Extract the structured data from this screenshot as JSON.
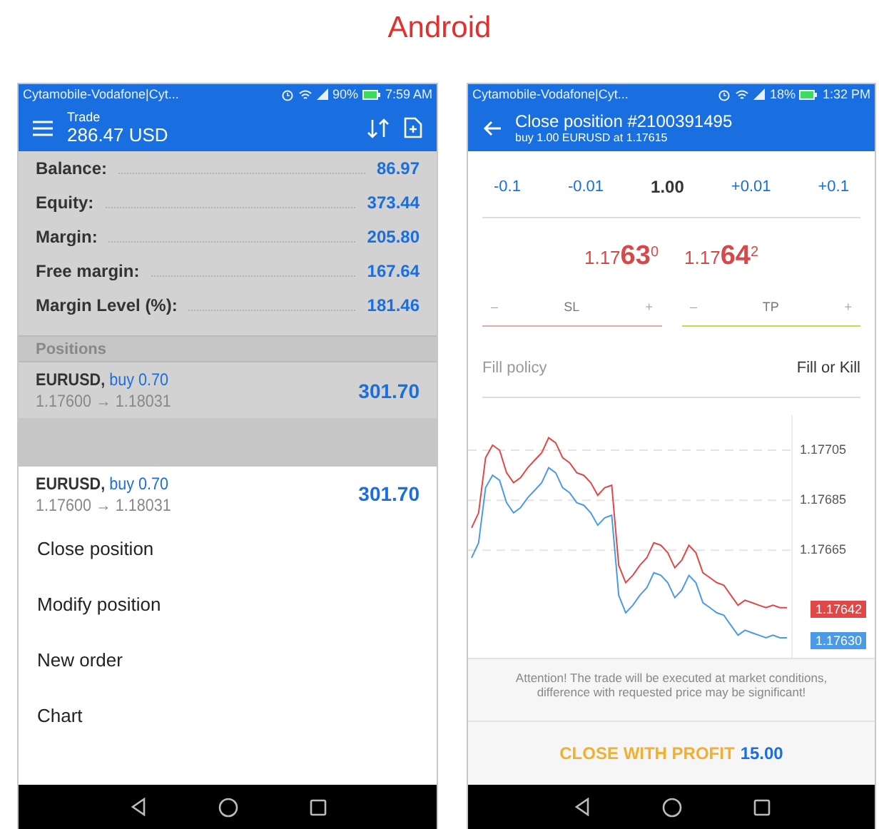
{
  "title": "Android",
  "trade_screen": {
    "status_bar": {
      "carrier": "Cytamobile-Vodafone|Cyt...",
      "battery": "90%",
      "time": "7:59 AM"
    },
    "header": {
      "title": "Trade",
      "balance": "286.47 USD"
    },
    "summary": [
      {
        "label": "Balance:",
        "value": "86.97"
      },
      {
        "label": "Equity:",
        "value": "373.44"
      },
      {
        "label": "Margin:",
        "value": "205.80"
      },
      {
        "label": "Free margin:",
        "value": "167.64"
      },
      {
        "label": "Margin Level (%):",
        "value": "181.46"
      }
    ],
    "positions_header": "Positions",
    "position": {
      "symbol": "EURUSD,",
      "side": "buy 0.70",
      "prices": "1.17600 → 1.18031",
      "profit": "301.70"
    },
    "context_menu": {
      "position": {
        "symbol": "EURUSD,",
        "side": "buy 0.70",
        "prices": "1.17600 → 1.18031",
        "profit": "301.70"
      },
      "items": [
        "Close position",
        "Modify position",
        "New order",
        "Chart"
      ]
    }
  },
  "close_screen": {
    "status_bar": {
      "carrier": "Cytamobile-Vodafone|Cyt...",
      "battery": "18%",
      "time": "1:32 PM"
    },
    "header": {
      "title": "Close position #2100391495",
      "subtitle": "buy 1.00 EURUSD at 1.17615"
    },
    "volume": {
      "steps_down": [
        "-0.1",
        "-0.01"
      ],
      "value": "1.00",
      "steps_up": [
        "+0.01",
        "+0.1"
      ]
    },
    "prices": [
      {
        "base": "1.17",
        "big": "63",
        "sup": "0"
      },
      {
        "base": "1.17",
        "big": "64",
        "sup": "2"
      }
    ],
    "stops": [
      {
        "minus": "–",
        "label": "SL",
        "plus": "+",
        "color": "#e8a8a8"
      },
      {
        "minus": "–",
        "label": "TP",
        "plus": "+",
        "color": "#c8d44a"
      }
    ],
    "fill_policy": {
      "label": "Fill policy",
      "value": "Fill or Kill"
    },
    "chart": {
      "chart_data": {
        "type": "line",
        "grid": true,
        "ylim": [
          1.17622,
          1.17719
        ],
        "yticks": [
          {
            "value": 1.17705,
            "label": "1.17705"
          },
          {
            "value": 1.17685,
            "label": "1.17685"
          },
          {
            "value": 1.17665,
            "label": "1.17665"
          }
        ],
        "series": [
          {
            "color": "#e04848",
            "values": [
              1.17674,
              1.1768,
              1.17702,
              1.17707,
              1.17705,
              1.17696,
              1.17692,
              1.17694,
              1.17698,
              1.17701,
              1.17704,
              1.1771,
              1.17708,
              1.17702,
              1.177,
              1.17696,
              1.17695,
              1.17692,
              1.17687,
              1.1769,
              1.17691,
              1.17659,
              1.17652,
              1.17655,
              1.17659,
              1.17662,
              1.17668,
              1.17667,
              1.17664,
              1.17658,
              1.17661,
              1.17667,
              1.17664,
              1.17656,
              1.17654,
              1.17652,
              1.17651,
              1.17647,
              1.17643,
              1.17645,
              1.17644,
              1.17643,
              1.17642,
              1.17643,
              1.17642,
              1.17642
            ]
          },
          {
            "color": "#4a9ae6",
            "values": [
              1.17662,
              1.17668,
              1.1769,
              1.17695,
              1.17693,
              1.17684,
              1.1768,
              1.17682,
              1.17686,
              1.17689,
              1.17692,
              1.17698,
              1.17696,
              1.1769,
              1.17688,
              1.17684,
              1.17683,
              1.1768,
              1.17675,
              1.17678,
              1.17679,
              1.17647,
              1.1764,
              1.17643,
              1.17647,
              1.1765,
              1.17656,
              1.17655,
              1.17652,
              1.17646,
              1.17649,
              1.17655,
              1.17652,
              1.17644,
              1.17642,
              1.1764,
              1.17639,
              1.17635,
              1.17631,
              1.17633,
              1.17632,
              1.17631,
              1.1763,
              1.17631,
              1.1763,
              1.1763
            ]
          }
        ]
      },
      "lines": [
        {
          "price": "1.17642",
          "color": "#e04848"
        },
        {
          "price": "1.17630",
          "color": "#4a9ae6"
        }
      ]
    },
    "notice": "Attention! The trade will be executed at market conditions, difference with requested price may be significant!",
    "close_button": {
      "label": "CLOSE WITH PROFIT",
      "amount": "15.00"
    }
  }
}
